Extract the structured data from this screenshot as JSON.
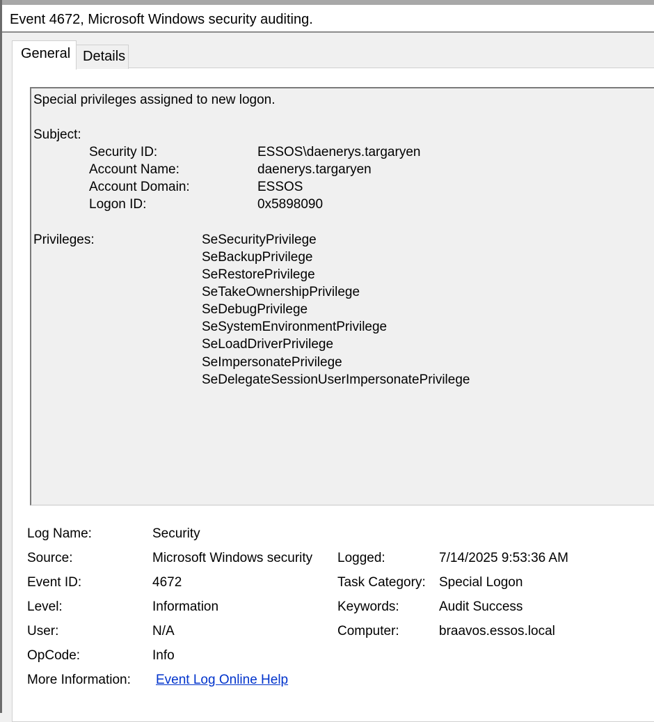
{
  "window": {
    "title": "Event 4672, Microsoft Windows security auditing."
  },
  "tabs": [
    {
      "label": "General",
      "selected": true
    },
    {
      "label": "Details",
      "selected": false
    }
  ],
  "description": {
    "summary": "Special privileges assigned to new logon.",
    "subject_heading": "Subject:",
    "subject": [
      {
        "label": "Security ID:",
        "value": "ESSOS\\daenerys.targaryen"
      },
      {
        "label": "Account Name:",
        "value": "daenerys.targaryen"
      },
      {
        "label": "Account Domain:",
        "value": "ESSOS"
      },
      {
        "label": "Logon ID:",
        "value": "0x5898090"
      }
    ],
    "privileges_heading": "Privileges:",
    "privileges": [
      "SeSecurityPrivilege",
      "SeBackupPrivilege",
      "SeRestorePrivilege",
      "SeTakeOwnershipPrivilege",
      "SeDebugPrivilege",
      "SeSystemEnvironmentPrivilege",
      "SeLoadDriverPrivilege",
      "SeImpersonatePrivilege",
      "SeDelegateSessionUserImpersonatePrivilege"
    ]
  },
  "details": {
    "log_name": {
      "label": "Log Name:",
      "value": "Security"
    },
    "source": {
      "label": "Source:",
      "value": "Microsoft Windows security"
    },
    "logged": {
      "label": "Logged:",
      "value": "7/14/2025 9:53:36 AM"
    },
    "event_id": {
      "label": "Event ID:",
      "value": "4672"
    },
    "task_category": {
      "label": "Task Category:",
      "value": "Special Logon"
    },
    "level": {
      "label": "Level:",
      "value": "Information"
    },
    "keywords": {
      "label": "Keywords:",
      "value": "Audit Success"
    },
    "user": {
      "label": "User:",
      "value": "N/A"
    },
    "computer": {
      "label": "Computer:",
      "value": "braavos.essos.local"
    },
    "opcode": {
      "label": "OpCode:",
      "value": "Info"
    },
    "more_info": {
      "label": "More Information:",
      "link_text": "Event Log Online Help"
    }
  },
  "colors": {
    "link": "#0033cc",
    "panel_bg": "#ffffff",
    "description_bg": "#f0f0f0"
  }
}
